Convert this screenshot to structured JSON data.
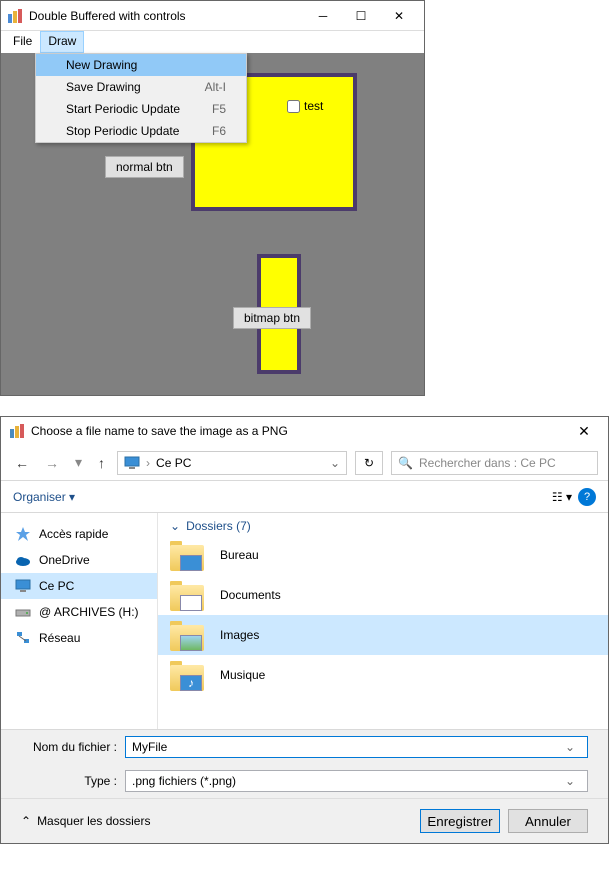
{
  "win1": {
    "title": "Double Buffered with controls",
    "menu": {
      "file": "File",
      "draw": "Draw"
    },
    "dropdown": [
      {
        "label": "New Drawing",
        "shortcut": "",
        "highlight": true
      },
      {
        "label": "Save Drawing",
        "shortcut": "Alt-I"
      },
      {
        "label": "Start Periodic Update",
        "shortcut": "F5"
      },
      {
        "label": "Stop Periodic Update",
        "shortcut": "F6"
      }
    ],
    "checkbox_label": "test",
    "normal_btn": "normal btn",
    "bitmap_btn": "bitmap btn"
  },
  "win2": {
    "title": "Choose a file name to save the image as a PNG",
    "path_label": "Ce PC",
    "search_placeholder": "Rechercher dans : Ce PC",
    "organiser": "Organiser ▾",
    "sidebar": {
      "quick": "Accès rapide",
      "onedrive": "OneDrive",
      "cepc": "Ce PC",
      "archives": "@ ARCHIVES (H:)",
      "reseau": "Réseau"
    },
    "folders_header": "Dossiers (7)",
    "folders": {
      "bureau": "Bureau",
      "documents": "Documents",
      "images": "Images",
      "musique": "Musique"
    },
    "filename_label": "Nom du fichier :",
    "filename_value": "MyFile",
    "type_label": "Type :",
    "type_value": ".png fichiers (*.png)",
    "hide_folders": "Masquer les dossiers",
    "save_btn": "Enregistrer",
    "cancel_btn": "Annuler"
  }
}
